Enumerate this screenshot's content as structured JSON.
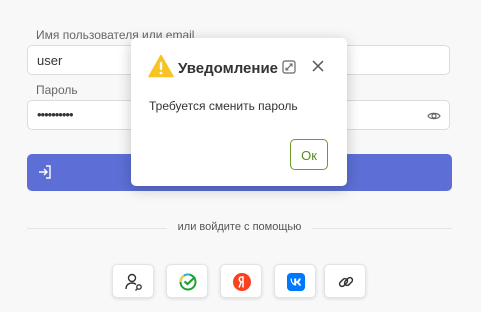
{
  "form": {
    "username_label": "Имя пользователя или email",
    "username_value": "user",
    "password_label": "Пароль",
    "password_value": "••••••••••",
    "divider_text": "или войдите с помощью"
  },
  "providers": [
    {
      "icon": "user-key-icon"
    },
    {
      "icon": "sber-icon",
      "color": "#21a038"
    },
    {
      "icon": "yandex-icon",
      "color": "#fc3f1d"
    },
    {
      "icon": "vk-icon",
      "color": "#0077ff"
    },
    {
      "icon": "link-icon"
    }
  ],
  "dialog": {
    "title": "Уведомление",
    "message": "Требуется сменить пароль",
    "ok_label": "Ок"
  },
  "colors": {
    "primary": "#5d6fd6",
    "ok_border": "#6b9b2a",
    "warning": "#f7c325"
  }
}
